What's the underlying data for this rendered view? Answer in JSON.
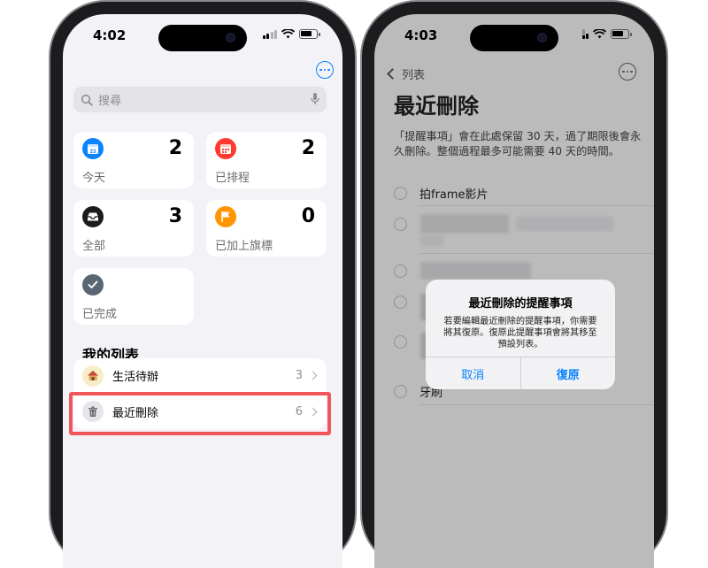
{
  "left_phone": {
    "status_time": "4:02",
    "search_placeholder": "搜尋",
    "smart_lists": [
      {
        "label": "今天",
        "count": "2",
        "icon": "calendar-icon",
        "color": "#0a84ff"
      },
      {
        "label": "已排程",
        "count": "2",
        "icon": "calendar-grid-icon",
        "color": "#ff3b30"
      },
      {
        "label": "全部",
        "count": "3",
        "icon": "tray-icon",
        "color": "#1c1c1e"
      },
      {
        "label": "已加上旗標",
        "count": "0",
        "icon": "flag-icon",
        "color": "#ff9500"
      },
      {
        "label": "已完成",
        "icon": "checkmark-icon",
        "color": "#5a6674"
      }
    ],
    "section_title": "我的列表",
    "lists": [
      {
        "name": "生活待辦",
        "count": "3",
        "icon": "house-emoji-icon"
      },
      {
        "name": "最近刪除",
        "count": "6",
        "icon": "trash-icon"
      }
    ]
  },
  "right_phone": {
    "status_time": "4:03",
    "back_label": "列表",
    "title": "最近刪除",
    "description": "「提醒事項」會在此處保留 30 天，過了期限後會永久刪除。整個過程最多可能需要 40 天的時間。",
    "items": [
      "拍frame影片",
      "牙刷"
    ],
    "alert": {
      "title": "最近刪除的提醒事項",
      "message": "若要編輯最近刪除的提醒事項，你需要將其復原。復原此提醒事項會將其移至預設列表。",
      "cancel": "取消",
      "restore": "復原"
    }
  },
  "colors": {
    "accent": "#0a84ff",
    "highlight": "#f0575a"
  }
}
